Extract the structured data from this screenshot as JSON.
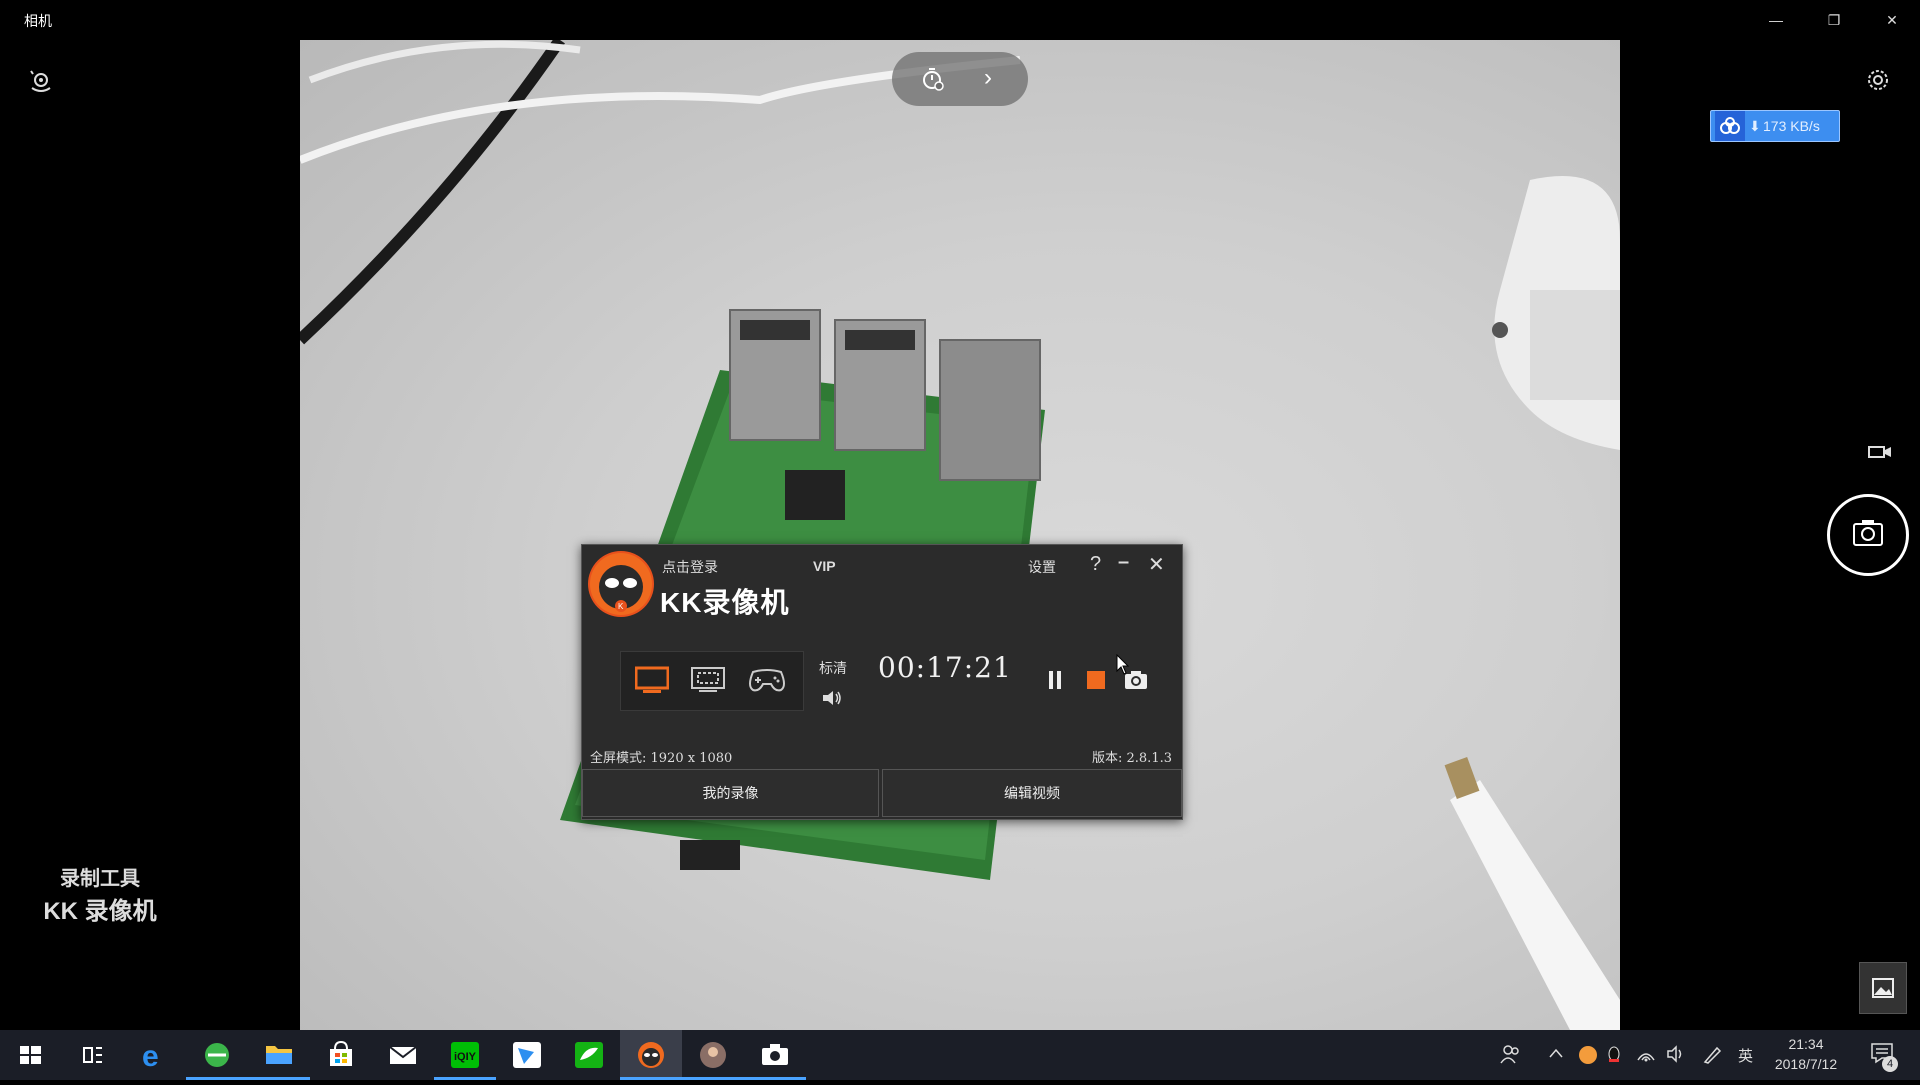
{
  "window": {
    "title": "相机"
  },
  "camera": {
    "timer_chevron": "›",
    "network_speed": "173 KB/s"
  },
  "kk_recorder": {
    "login": "点击登录",
    "vip": "VIP",
    "settings": "设置",
    "help": "?",
    "minimize": "–",
    "close": "✕",
    "title": "KK录像机",
    "quality": "标清",
    "timer": "00:17:21",
    "mode_info": "全屏模式: 1920 x 1080",
    "version": "版本: 2.8.1.3",
    "tab_my_recordings": "我的录像",
    "tab_edit_video": "编辑视频"
  },
  "watermark": {
    "line1": "录制工具",
    "line2": "KK 录像机"
  },
  "taskbar": {
    "ime": "英",
    "time": "21:34",
    "date": "2018/7/12",
    "notification_count": "4",
    "apps": [
      "start",
      "task-view",
      "edge",
      "browser",
      "file-explorer",
      "store",
      "mail",
      "iqiyi",
      "feishu",
      "wechat-files",
      "kk-recorder",
      "avatar-app",
      "camera"
    ]
  },
  "colors": {
    "accent_blue": "#4aa3ff",
    "kk_orange": "#f06a1f",
    "network_badge": "#3d8ef0"
  }
}
